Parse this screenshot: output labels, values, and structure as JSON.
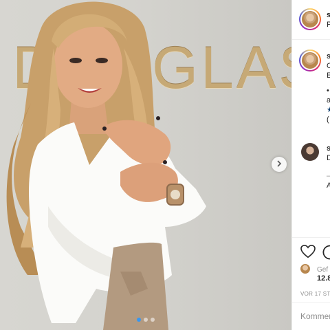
{
  "photo": {
    "wall_text": "DOUGLAS",
    "carousel": {
      "slides": 3,
      "active_index": 0
    }
  },
  "header": {
    "username": "s",
    "location": "P"
  },
  "caption": {
    "username": "s",
    "lines": [
      "C",
      "E",
      "•",
      "a",
      "★",
      "("
    ]
  },
  "comment": {
    "username": "s",
    "text": "D",
    "extra": [
      "—",
      "A"
    ]
  },
  "actions": {
    "likes_label": "Gef",
    "likes_count": "12.8",
    "timestamp": "VOR 17 STU"
  },
  "add_comment": {
    "placeholder": "Kommen"
  },
  "colors": {
    "accent": "#3897f0",
    "wall_text": "#c6a976",
    "border": "#efefef"
  }
}
